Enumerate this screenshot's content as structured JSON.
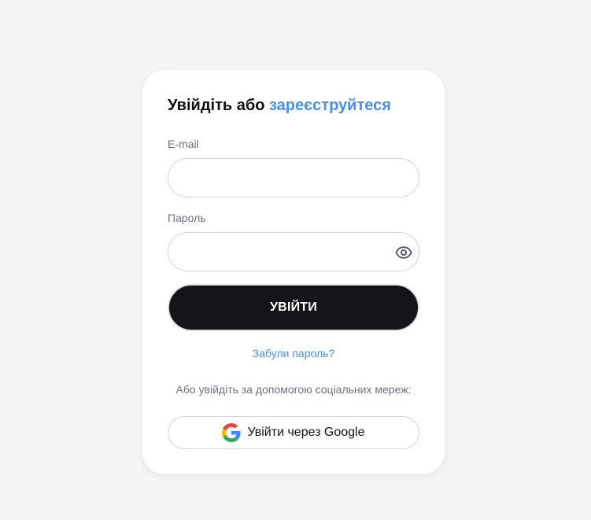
{
  "login": {
    "heading_prefix": "Увійдіть або",
    "heading_link": "зареєструйтеся",
    "email_label": "E-mail",
    "email_value": "",
    "password_label": "Пароль",
    "password_value": "",
    "password_toggle_icon": "eye-icon",
    "submit_label": "УВІЙТИ",
    "forgot_link": "Забули пароль?",
    "social_caption": "Або увійдіть за допомогою соціальних мереж:",
    "google_button_label": "Увійти через Google",
    "google_icon": "google-icon"
  },
  "colors": {
    "page_background": "#f3f4f6",
    "card_background": "#ffffff",
    "accent": "#4a8fe8",
    "primary_button": "#151418",
    "muted_text": "#6b7280"
  }
}
